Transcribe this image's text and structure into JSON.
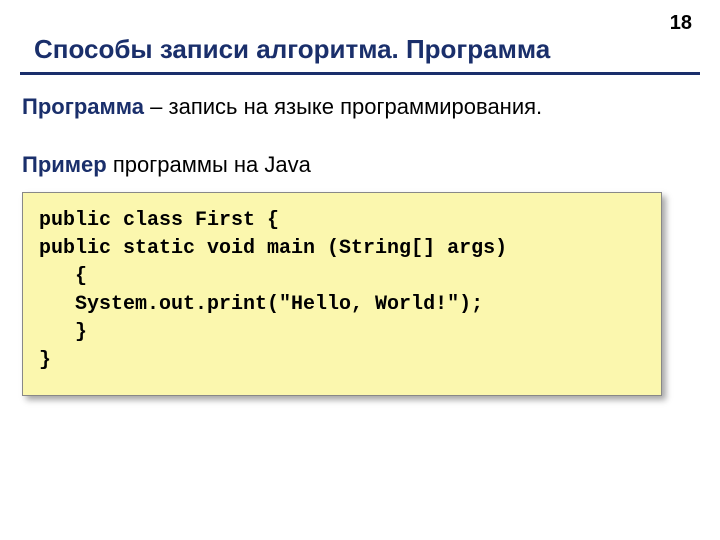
{
  "page_number": "18",
  "title": "Способы записи алгоритма. Программа",
  "definition": {
    "term": "Программа",
    "rest": " – запись на языке программирования."
  },
  "example": {
    "term": "Пример",
    "rest": " программы на Java"
  },
  "code": "public class First {\npublic static void main (String[] args)\n   {\n   System.out.print(\"Hello, World!\");\n   }\n}"
}
